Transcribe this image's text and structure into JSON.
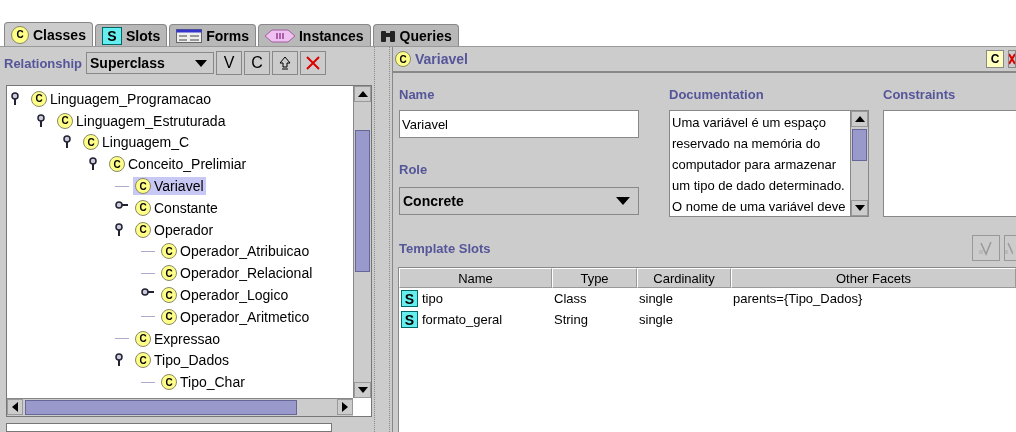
{
  "tabs": [
    {
      "label": "Classes",
      "icon": "C",
      "kind": "class",
      "selected": true
    },
    {
      "label": "Slots",
      "icon": "S",
      "kind": "slot",
      "selected": false
    },
    {
      "label": "Forms",
      "kind": "form",
      "selected": false
    },
    {
      "label": "Instances",
      "kind": "instance",
      "selected": false
    },
    {
      "label": "Queries",
      "kind": "query",
      "selected": false
    }
  ],
  "toolbar": {
    "label": "Relationship",
    "combo": "Superclass",
    "buttons": [
      {
        "kind": "text",
        "label": "V"
      },
      {
        "kind": "text",
        "label": "C"
      },
      {
        "kind": "up"
      },
      {
        "kind": "delete"
      }
    ]
  },
  "tree": [
    {
      "label": "Linguagem_Programacao",
      "icon": "C",
      "selected": false,
      "expanded": true,
      "children": [
        {
          "label": "Linguagem_Estruturada",
          "icon": "C",
          "selected": false,
          "expanded": true,
          "children": [
            {
              "label": "Linguagem_C",
              "icon": "C",
              "selected": false,
              "expanded": true,
              "children": [
                {
                  "label": "Conceito_Prelimiar",
                  "icon": "C",
                  "selected": false,
                  "expanded": true,
                  "children": [
                    {
                      "label": "Variavel",
                      "icon": "C",
                      "selected": true
                    },
                    {
                      "label": "Constante",
                      "icon": "C",
                      "selected": false,
                      "expanded": false
                    },
                    {
                      "label": "Operador",
                      "icon": "C",
                      "selected": false,
                      "expanded": true,
                      "children": [
                        {
                          "label": "Operador_Atribuicao",
                          "icon": "C",
                          "selected": false
                        },
                        {
                          "label": "Operador_Relacional",
                          "icon": "C",
                          "selected": false
                        },
                        {
                          "label": "Operador_Logico",
                          "icon": "C",
                          "selected": false,
                          "expanded": false
                        },
                        {
                          "label": "Operador_Aritmetico",
                          "icon": "C",
                          "selected": false
                        }
                      ]
                    },
                    {
                      "label": "Expressao",
                      "icon": "C",
                      "selected": false
                    },
                    {
                      "label": "Tipo_Dados",
                      "icon": "C",
                      "selected": false,
                      "expanded": true,
                      "children": [
                        {
                          "label": "Tipo_Char",
                          "icon": "C",
                          "selected": false
                        }
                      ]
                    }
                  ]
                }
              ]
            }
          ]
        }
      ]
    }
  ],
  "detail": {
    "icon": "C",
    "title": "Variavel",
    "header_button": "C",
    "name_label": "Name",
    "name_value": "Variavel",
    "role_label": "Role",
    "role_value": "Concrete",
    "doc_label": "Documentation",
    "doc_text": "Uma variável é um espaço reservado na memória do computador para armazenar um tipo de dado determinado. O nome de uma variável deve",
    "constraints_label": "Constraints",
    "slots_label": "Template Slots",
    "columns": [
      "Name",
      "Type",
      "Cardinality",
      "Other Facets"
    ],
    "rows": [
      {
        "icon": "S",
        "name": "tipo",
        "type": "Class",
        "cardinality": "single",
        "facets": "parents={Tipo_Dados}"
      },
      {
        "icon": "S",
        "name": "formato_geral",
        "type": "String",
        "cardinality": "single",
        "facets": ""
      }
    ]
  }
}
